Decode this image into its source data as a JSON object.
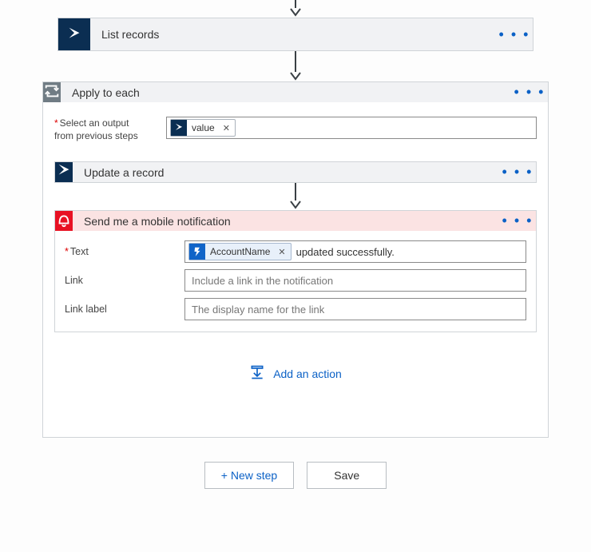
{
  "connector_arrow": true,
  "list_records": {
    "title": "List records"
  },
  "apply_to_each": {
    "title": "Apply to each",
    "select_output_label_pre": "Select an output from previous steps",
    "select_output_label_line1": "Select an output",
    "select_output_label_line2": "from previous steps",
    "token_value": "value"
  },
  "update_record": {
    "title": "Update a record"
  },
  "notification": {
    "title": "Send me a mobile notification",
    "text_label": "Text",
    "text_token": "AccountName",
    "text_suffix": " updated successfully.",
    "link_label": "Link",
    "link_placeholder": "Include a link in the notification",
    "link_label_label": "Link label",
    "link_label_placeholder": "The display name for the link"
  },
  "add_action_label": "Add an action",
  "footer": {
    "new_step": "+ New step",
    "save": "Save"
  },
  "menu_dots": "• • •"
}
